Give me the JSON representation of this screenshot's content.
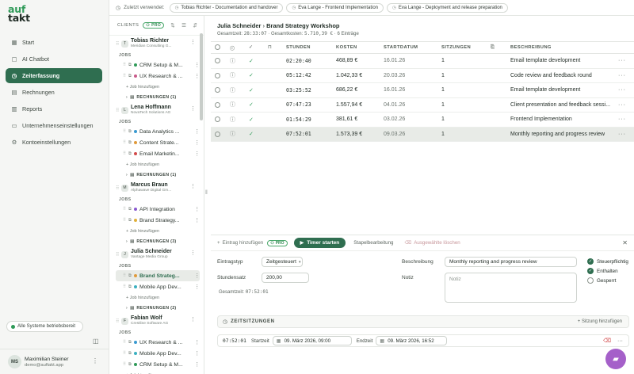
{
  "brand": {
    "logo_top": "auf",
    "logo_bottom": "takt"
  },
  "nav": [
    {
      "label": "Start",
      "icon": "grid-icon",
      "active": false
    },
    {
      "label": "AI Chatbot",
      "icon": "chat-icon",
      "active": false
    },
    {
      "label": "Zeiterfassung",
      "icon": "clock-icon",
      "active": true
    },
    {
      "label": "Rechnungen",
      "icon": "invoice-icon",
      "active": false
    },
    {
      "label": "Reports",
      "icon": "chart-icon",
      "active": false
    },
    {
      "label": "Unternehmenseinstellungen",
      "icon": "building-icon",
      "active": false
    },
    {
      "label": "Kontoeinstellungen",
      "icon": "settings-icon",
      "active": false
    }
  ],
  "system_status": {
    "label": "Alle Systeme betriebsbereit",
    "color": "#2f9a58"
  },
  "user": {
    "initials": "MS",
    "name": "Maximilian Steiner",
    "email": "demo@auftakt.app"
  },
  "recent": {
    "label": "Zuletzt verwendet:",
    "chips": [
      "Tobias Richter - Documentation and handover",
      "Eva Lange - Frontend Implementation",
      "Eva Lange - Deployment and release preparation"
    ]
  },
  "clients_panel": {
    "header": "CLIENTS",
    "pro": "PRO",
    "jobs_label": "JOBS",
    "add_job": "+ Job hinzufügen",
    "clients": [
      {
        "initial": "T",
        "name": "Tobias Richter",
        "company": "Meridian Consulting G...",
        "jobs": [
          {
            "name": "CRM Setup & M...",
            "color": "#2f9a58"
          },
          {
            "name": "UX Research & ...",
            "color": "#c85a8a"
          }
        ],
        "invoices": "RECHNUNGEN (1)"
      },
      {
        "initial": "L",
        "name": "Lena Hoffmann",
        "company": "NovaTech Solutions AG",
        "jobs": [
          {
            "name": "Data Analytics ...",
            "color": "#3a9ad0"
          },
          {
            "name": "Content Strate...",
            "color": "#e09a3a"
          },
          {
            "name": "Email Marketin...",
            "color": "#d24a4a"
          }
        ],
        "invoices": "RECHNUNGEN (1)"
      },
      {
        "initial": "M",
        "name": "Marcus Braun",
        "company": "Alphawave Digital Gm...",
        "jobs": [
          {
            "name": "API Integration",
            "color": "#8a5ad0"
          },
          {
            "name": "Brand Strategy...",
            "color": "#e0b03a"
          }
        ],
        "invoices": "RECHNUNGEN (3)"
      },
      {
        "initial": "J",
        "name": "Julia Schneider",
        "company": "Vantage Media Group",
        "jobs": [
          {
            "name": "Brand Strateg...",
            "color": "#e09a3a",
            "active": true
          },
          {
            "name": "Mobile App Dev...",
            "color": "#3ab0c0"
          }
        ],
        "invoices": "RECHNUNGEN (2)"
      },
      {
        "initial": "F",
        "name": "Fabian Wolf",
        "company": "Crestline Software AG",
        "jobs": [
          {
            "name": "UX Research & ...",
            "color": "#3a9ad0"
          },
          {
            "name": "Mobile App Dev...",
            "color": "#3ab0c0"
          },
          {
            "name": "CRM Setup & M...",
            "color": "#2f9a58"
          }
        ],
        "invoices": ""
      }
    ]
  },
  "main": {
    "client": "Julia Schneider",
    "job": "Brand Strategy Workshop",
    "summary_time_label": "Gesamtzeit:",
    "summary_time": "28:33:07",
    "summary_cost_label": "Gesamtkosten:",
    "summary_cost": "5.710,39 €",
    "summary_count": "6 Einträge",
    "columns": {
      "hours": "STUNDEN",
      "cost": "KOSTEN",
      "start": "STARTDATUM",
      "sessions": "SITZUNGEN",
      "desc": "BESCHREIBUNG"
    },
    "rows": [
      {
        "time": "02:20:40",
        "cost": "468,89 €",
        "date": "16.01.26",
        "sessions": "1",
        "desc": "Email template development",
        "selected": false
      },
      {
        "time": "05:12:42",
        "cost": "1.042,33 €",
        "date": "20.03.26",
        "sessions": "1",
        "desc": "Code review and feedback round",
        "selected": false
      },
      {
        "time": "03:25:52",
        "cost": "686,22 €",
        "date": "16.01.26",
        "sessions": "1",
        "desc": "Email template development",
        "selected": false
      },
      {
        "time": "07:47:23",
        "cost": "1.557,94 €",
        "date": "04.01.26",
        "sessions": "1",
        "desc": "Client presentation and feedback sessi...",
        "selected": false
      },
      {
        "time": "01:54:29",
        "cost": "381,61 €",
        "date": "03.02.26",
        "sessions": "1",
        "desc": "Frontend Implementation",
        "selected": false
      },
      {
        "time": "07:52:01",
        "cost": "1.573,39 €",
        "date": "09.03.26",
        "sessions": "1",
        "desc": "Monthly reporting and progress review",
        "selected": true
      }
    ]
  },
  "editor": {
    "add_entry": "Eintrag hinzufügen",
    "pro": "PRO",
    "timer": "Timer starten",
    "batch": "Stapelbearbeitung",
    "delete": "Ausgewählte löschen",
    "type_label": "Eintragstyp",
    "type_value": "Zeitgesteuert",
    "rate_label": "Stundensatz",
    "rate_value": "200,00",
    "total_label": "Gesamtzeit:",
    "total_value": "07:52:01",
    "desc_label": "Beschreibung",
    "desc_value": "Monthly reporting and progress review",
    "notes_label": "Notiz",
    "notes_placeholder": "Notiz",
    "opts": [
      {
        "label": "Steuerpflichtig",
        "on": true
      },
      {
        "label": "Enthalten",
        "on": true
      },
      {
        "label": "Gesperrt",
        "on": false
      }
    ],
    "sessions_title": "ZEITSITZUNGEN",
    "sessions_add": "+ Sitzung hinzufügen",
    "session": {
      "time": "07:52:01",
      "start_label": "Startzeit",
      "start": "09. März 2026, 09:00",
      "end_label": "Endzeit",
      "end": "09. März 2026, 16:52"
    }
  }
}
